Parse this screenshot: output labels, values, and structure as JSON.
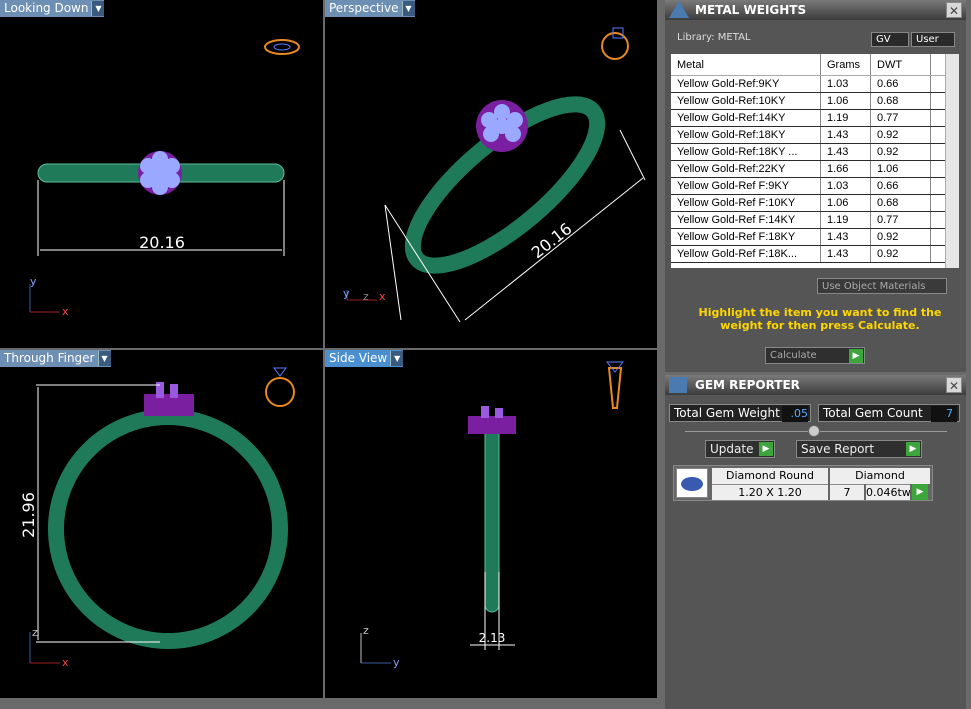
{
  "viewports": {
    "top_left": {
      "title": "Looking Down",
      "dimension": "20.16",
      "axis_y": "y",
      "axis_x": "x"
    },
    "top_right": {
      "title": "Perspective",
      "dimension": "20.16",
      "axis_y": "y",
      "axis_z": "z",
      "axis_x": "x"
    },
    "bottom_left": {
      "title": "Through Finger",
      "dimension": "21.96",
      "axis_z": "z",
      "axis_x": "x"
    },
    "bottom_right": {
      "title": "Side View",
      "dimension": "2.13",
      "axis_z": "z",
      "axis_y": "y"
    }
  },
  "metal_weights": {
    "title": "METAL WEIGHTS",
    "library_label": "Library: METAL",
    "toggle_gv": "GV",
    "toggle_user": "User",
    "columns": [
      "Metal",
      "Grams",
      "DWT"
    ],
    "rows": [
      [
        "Yellow Gold-Ref:9KY",
        "1.03",
        "0.66"
      ],
      [
        "Yellow Gold-Ref:10KY",
        "1.06",
        "0.68"
      ],
      [
        "Yellow Gold-Ref:14KY",
        "1.19",
        "0.77"
      ],
      [
        "Yellow Gold-Ref:18KY",
        "1.43",
        "0.92"
      ],
      [
        "Yellow Gold-Ref:18KY ...",
        "1.43",
        "0.92"
      ],
      [
        "Yellow Gold-Ref:22KY",
        "1.66",
        "1.06"
      ],
      [
        "Yellow Gold-Ref F:9KY",
        "1.03",
        "0.66"
      ],
      [
        "Yellow Gold-Ref F:10KY",
        "1.06",
        "0.68"
      ],
      [
        "Yellow Gold-Ref F:14KY",
        "1.19",
        "0.77"
      ],
      [
        "Yellow Gold-Ref F:18KY",
        "1.43",
        "0.92"
      ],
      [
        "Yellow Gold-Ref F:18K...",
        "1.43",
        "0.92"
      ]
    ],
    "use_object_materials": "Use Object Materials",
    "hint": "Highlight the item you want to find the weight for then press Calculate.",
    "calculate": "Calculate"
  },
  "gem_reporter": {
    "title": "GEM REPORTER",
    "total_weight_label": "Total Gem Weight",
    "total_weight_value": ".05",
    "total_count_label": "Total Gem Count",
    "total_count_value": "7",
    "update": "Update",
    "save_report": "Save Report",
    "gem": {
      "shape": "Diamond Round",
      "material": "Diamond",
      "size": "1.20 X 1.20",
      "count": "7",
      "weight": "0.046tw"
    }
  },
  "colors": {
    "ring": "#1f7a5a",
    "gem": "#9aa8ff",
    "prong": "#7a1fa0",
    "accent": "#ffd700"
  }
}
